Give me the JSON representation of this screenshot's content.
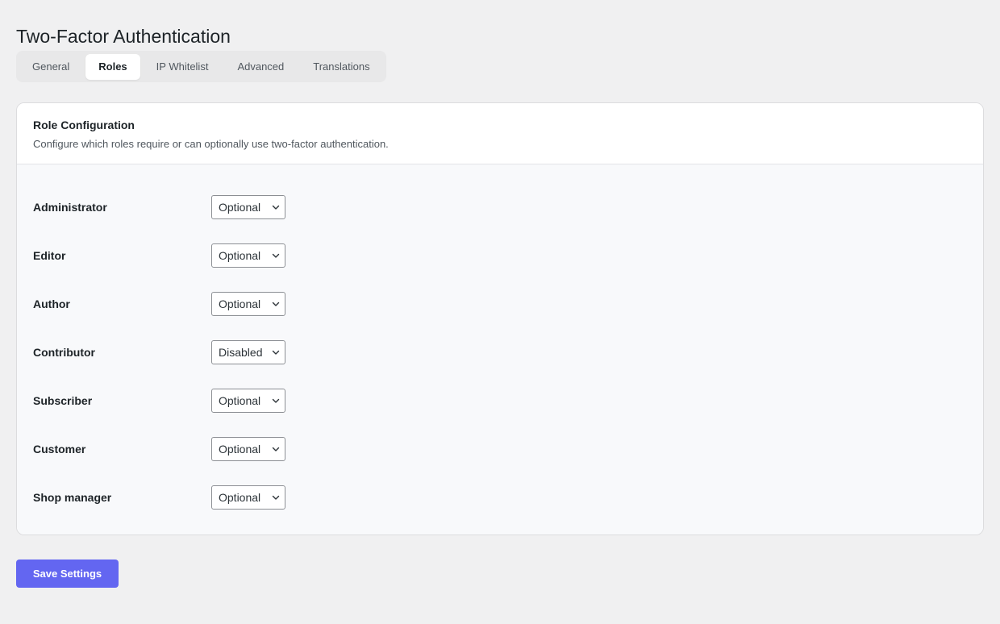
{
  "page": {
    "title": "Two-Factor Authentication"
  },
  "tabs": [
    {
      "label": "General",
      "active": false
    },
    {
      "label": "Roles",
      "active": true
    },
    {
      "label": "IP Whitelist",
      "active": false
    },
    {
      "label": "Advanced",
      "active": false
    },
    {
      "label": "Translations",
      "active": false
    }
  ],
  "card": {
    "title": "Role Configuration",
    "description": "Configure which roles require or can optionally use two-factor authentication."
  },
  "roles": [
    {
      "label": "Administrator",
      "value": "Optional"
    },
    {
      "label": "Editor",
      "value": "Optional"
    },
    {
      "label": "Author",
      "value": "Optional"
    },
    {
      "label": "Contributor",
      "value": "Disabled"
    },
    {
      "label": "Subscriber",
      "value": "Optional"
    },
    {
      "label": "Customer",
      "value": "Optional"
    },
    {
      "label": "Shop manager",
      "value": "Optional"
    }
  ],
  "actions": {
    "save_label": "Save Settings"
  },
  "colors": {
    "accent": "#6366f1",
    "background": "#f0f0f1"
  },
  "icons": {
    "select_chevron": "chevron-down-icon"
  }
}
